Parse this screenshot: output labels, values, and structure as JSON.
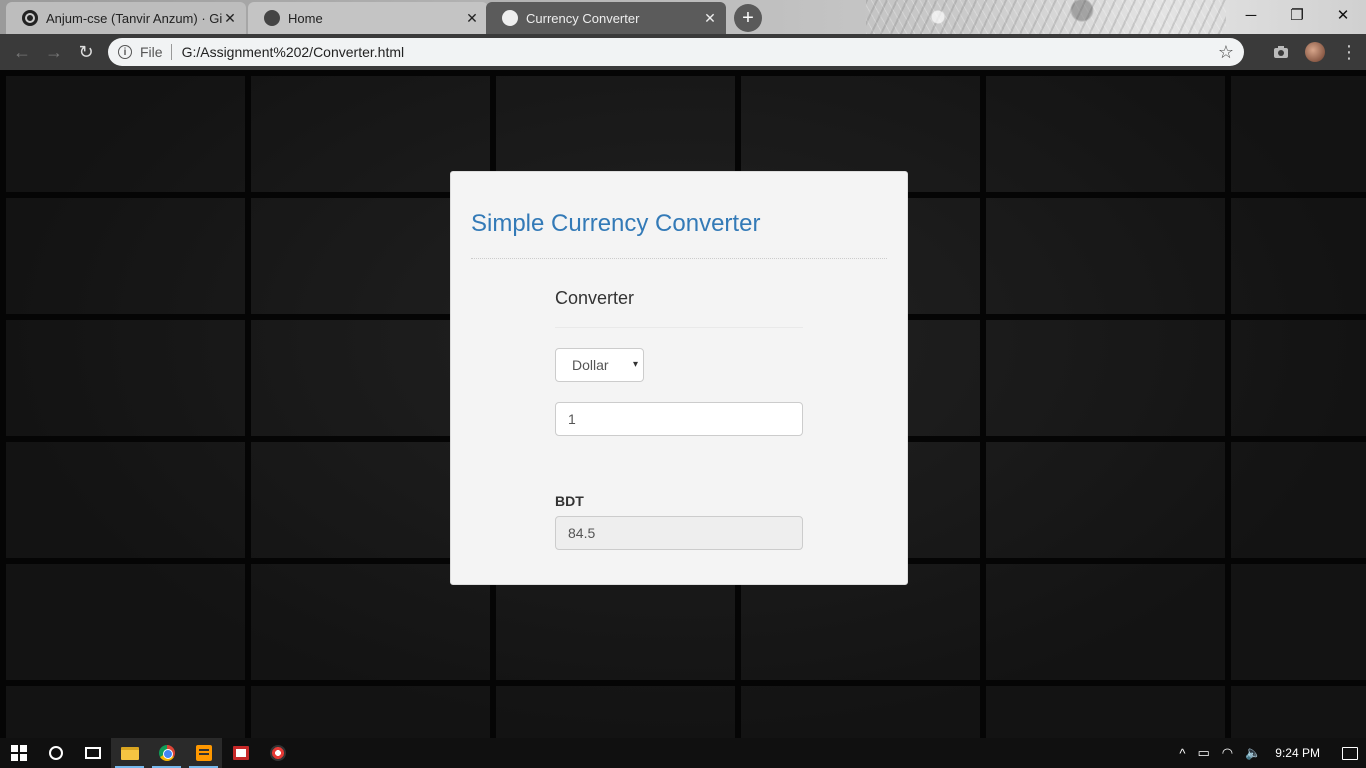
{
  "browser": {
    "tabs": [
      {
        "title": "Anjum-cse (Tanvir Anzum) · GitHub",
        "icon": "github-icon",
        "active": false
      },
      {
        "title": "Home",
        "icon": "globe-icon",
        "active": false
      },
      {
        "title": "Currency Converter",
        "icon": "globe-icon",
        "active": true
      }
    ],
    "omnibox": {
      "scheme": "File",
      "url": "G:/Assignment%202/Converter.html"
    },
    "icons": {
      "back": "←",
      "forward": "→",
      "reload": "↻",
      "info": "i",
      "star": "☆",
      "close": "✕",
      "new_tab": "+",
      "minimize": "─",
      "maximize": "❐",
      "window_close": "✕",
      "kebab": "⋮"
    }
  },
  "app": {
    "title": "Simple Currency Converter",
    "section_title": "Converter",
    "currency_select": {
      "selected": "Dollar",
      "caret": "▾"
    },
    "amount_input": {
      "value": "1"
    },
    "result": {
      "label": "BDT",
      "value": "84.5"
    },
    "accent_color": "#337ab7"
  },
  "taskbar": {
    "clock": "9:24 PM",
    "tray_icons": {
      "chevron": "^",
      "battery": "▭",
      "wifi": "◠",
      "volume": "🔈"
    }
  }
}
